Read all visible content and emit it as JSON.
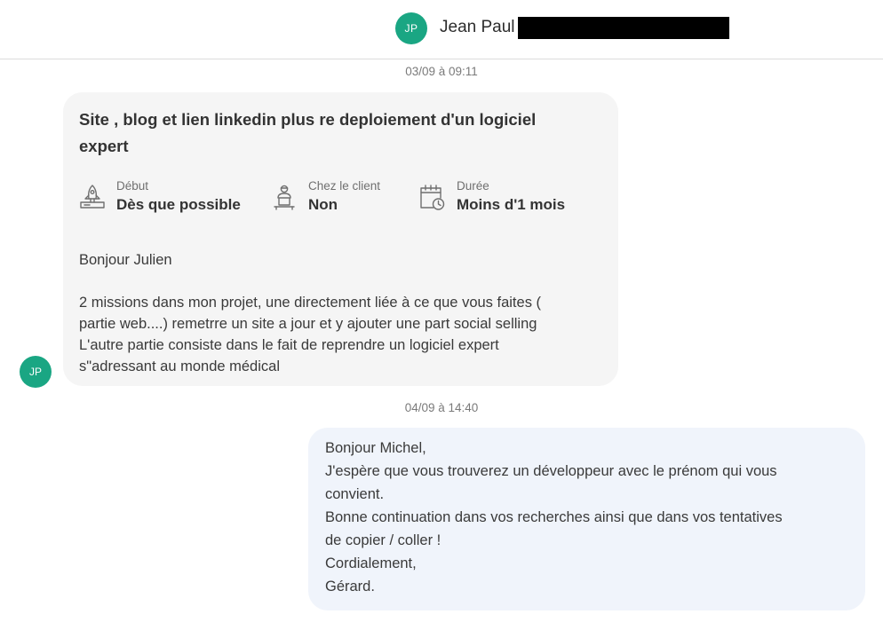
{
  "header": {
    "avatar_initials": "JP",
    "contact_name": "Jean Paul"
  },
  "messages": [
    {
      "timestamp": "03/09 à 09:11",
      "avatar_initials": "JP",
      "title_lines": [
        "Site , blog et lien linkedin plus re deploiement d'un logiciel",
        "expert"
      ],
      "meta": [
        {
          "icon": "rocket-launch-icon",
          "label": "Début",
          "value": "Dès que possible"
        },
        {
          "icon": "person-at-desk-icon",
          "label": "Chez le client",
          "value": "Non"
        },
        {
          "icon": "calendar-clock-icon",
          "label": "Durée",
          "value": "Moins d'1 mois"
        }
      ],
      "greeting": "Bonjour Julien",
      "body_lines": [
        "2 missions dans mon projet, une directement liée à ce que vous faites (",
        "partie web....) remetrre un site a jour et y ajouter une part social selling",
        "L'autre partie consiste dans le fait de reprendre un logiciel expert",
        "s\"adressant au monde médical"
      ]
    },
    {
      "timestamp": "04/09 à 14:40",
      "body_lines": [
        "Bonjour Michel,",
        "J'espère que vous trouverez un développeur avec le prénom qui vous",
        "convient.",
        "Bonne continuation dans vos recherches ainsi que dans vos tentatives",
        "de copier / coller !",
        "Cordialement,",
        "Gérard."
      ]
    }
  ],
  "colors": {
    "avatar": "#1aa683",
    "incoming_bubble": "#f5f5f5",
    "outgoing_bubble": "#f0f4fb"
  }
}
